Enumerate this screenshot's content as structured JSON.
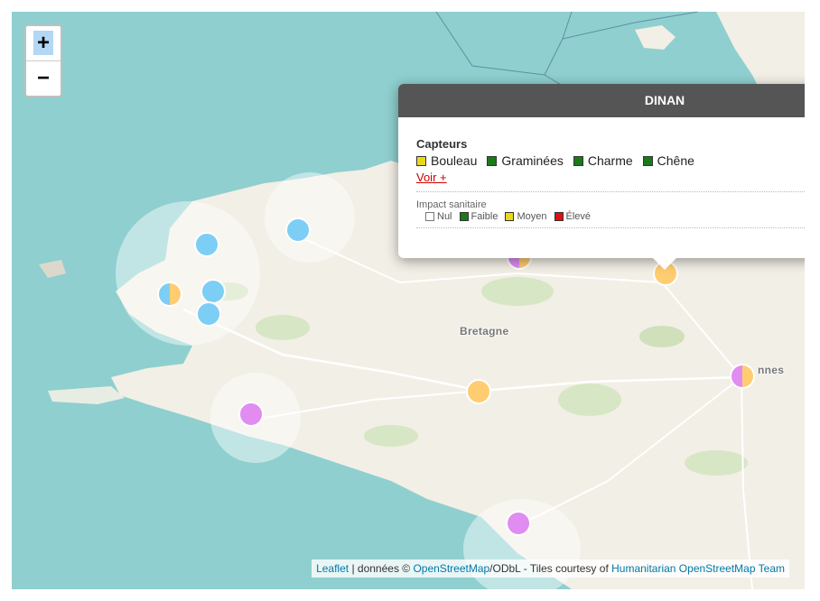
{
  "map": {
    "place_label": "Bretagne",
    "partial_label": "nnes",
    "colors": {
      "sea": "#8fcfcf",
      "land": "#f2efe6"
    }
  },
  "zoom": {
    "in_label": "+",
    "out_label": "−"
  },
  "markers": [
    {
      "color": "#7dcef5"
    },
    {
      "color": "#7dcef5"
    },
    {
      "color": "#7dcef5"
    },
    {
      "color": "#7dcef5"
    },
    {
      "color": "#ffcd70"
    },
    {
      "color": "#e08cf0"
    },
    {
      "color": "#ffcd70"
    },
    {
      "color": "#e08cf0"
    }
  ],
  "popup": {
    "title": "DINAN",
    "capteurs_title": "Capteurs",
    "capteurs": [
      {
        "label": "Bouleau",
        "color": "#e8d81a"
      },
      {
        "label": "Graminées",
        "color": "#1a7a1a"
      },
      {
        "label": "Charme",
        "color": "#1a7a1a"
      },
      {
        "label": "Chêne",
        "color": "#1a7a1a"
      }
    ],
    "voir_label": "Voir +",
    "impact_title": "Impact sanitaire",
    "impact": [
      {
        "label": "Nul",
        "color": "#ffffff"
      },
      {
        "label": "Faible",
        "color": "#1a7a1a"
      },
      {
        "label": "Moyen",
        "color": "#e8d81a"
      },
      {
        "label": "Élevé",
        "color": "#dd1111"
      }
    ]
  },
  "attribution": {
    "leaflet": "Leaflet",
    "sep1": " | données © ",
    "osm": "OpenStreetMap",
    "sep2": "/ODbL - Tiles courtesy of ",
    "hot": "Humanitarian OpenStreetMap Team"
  }
}
